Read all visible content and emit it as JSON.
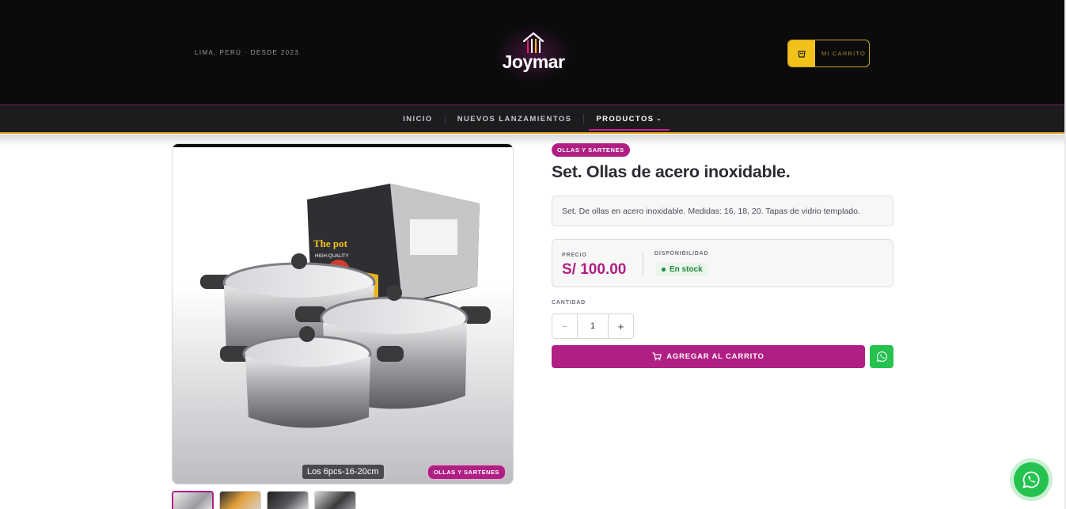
{
  "header": {
    "location": "LIMA, PERÚ · DESDE 2023",
    "logo_text": "Joymar",
    "cart_label": "MI CARRITO"
  },
  "nav": {
    "items": [
      {
        "label": "INICIO"
      },
      {
        "label": "NUEVOS LANZAMIENTOS"
      },
      {
        "label": "PRODUCTOS",
        "chevron": "⌄"
      }
    ],
    "active": "PRODUCTOS"
  },
  "product": {
    "category": "OLLAS Y SARTENES",
    "title": "Set. Ollas de acero inoxidable.",
    "description": "Set. De ollas en acero inoxidable. Medidas: 16, 18, 20. Tapas de vidrio templado.",
    "price_label": "PRECIO",
    "price": "S/ 100.00",
    "availability_label": "DISPONIBILIDAD",
    "availability": "En stock",
    "quantity_label": "CANTIDAD",
    "quantity": "1",
    "minus": "−",
    "plus": "+",
    "add_to_cart": "AGREGAR AL CARRITO",
    "image_caption": "Los 6pcs-16-20cm",
    "image_badge": "OLLAS Y SARTENES",
    "box_text": "The pot",
    "box_subtext": "HIGH-QUALITY"
  },
  "colors": {
    "brand": "#b01f83",
    "accent_gold": "#f2c21b",
    "whatsapp": "#25c24f",
    "stock_green": "#1e8a3a"
  },
  "icons": [
    "cart-icon",
    "whatsapp-icon",
    "logo-house-icon"
  ]
}
